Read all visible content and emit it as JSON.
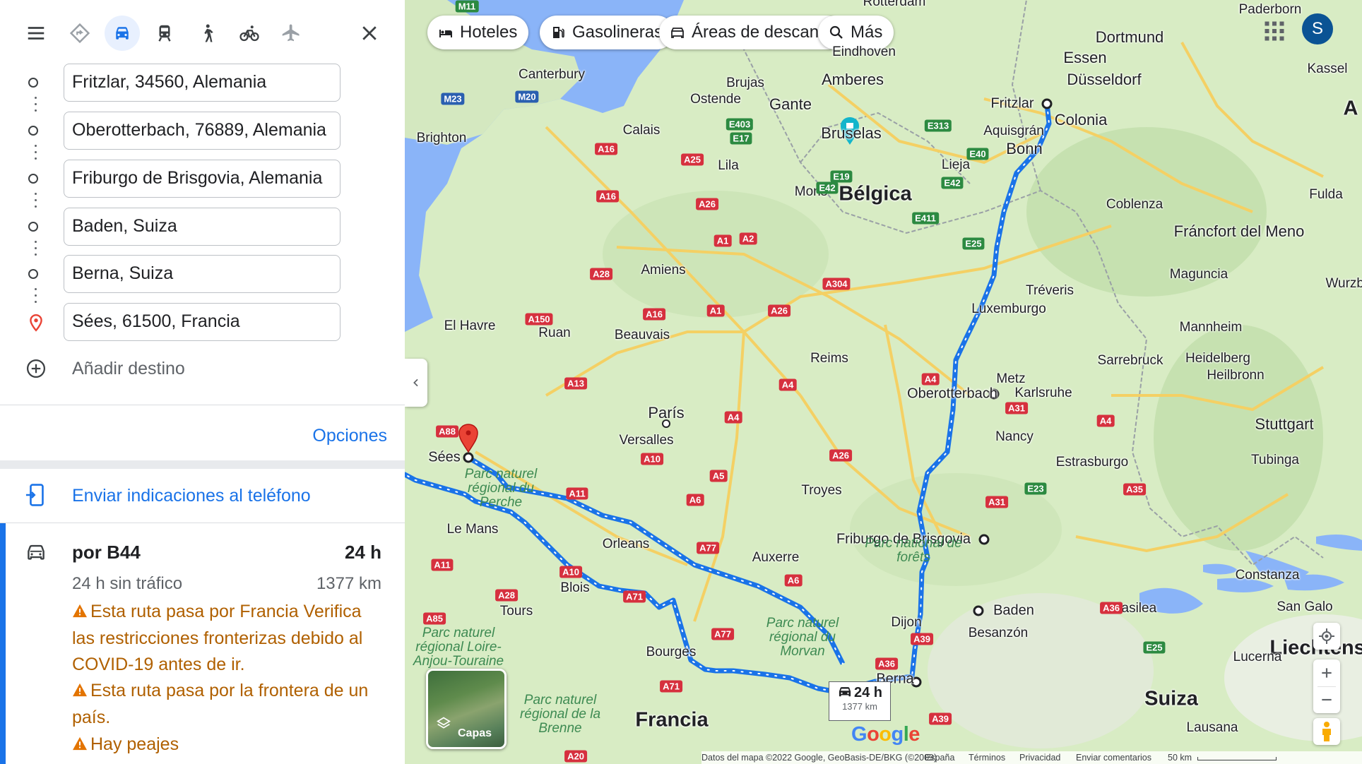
{
  "sidebar": {
    "toolbar": {
      "menu_icon": "menu-icon",
      "modes": [
        {
          "name": "Mejor ruta",
          "icon": "directions-icon",
          "active": false
        },
        {
          "name": "Coche",
          "icon": "car-icon",
          "active": true
        },
        {
          "name": "Transporte público",
          "icon": "train-icon",
          "active": false
        },
        {
          "name": "A pie",
          "icon": "walk-icon",
          "active": false
        },
        {
          "name": "Bicicleta",
          "icon": "bike-icon",
          "active": false
        },
        {
          "name": "Vuelo",
          "icon": "plane-icon",
          "active": false
        }
      ],
      "close_icon": "close-icon"
    },
    "stops": [
      "Fritzlar, 34560, Alemania",
      "Oberotterbach, 76889, Alemania",
      "Friburgo de Brisgovia, Alemania",
      "Baden, Suiza",
      "Berna, Suiza",
      "Sées, 61500, Francia"
    ],
    "add_destination": "Añadir destino",
    "options": "Opciones",
    "send_to_phone": "Enviar indicaciones al teléfono",
    "route": {
      "via": "por B44",
      "time": "24 h",
      "traffic": "24 h sin tráfico",
      "distance": "1377 km",
      "warnings": [
        "Esta ruta pasa por Francia Verifica las restricciones fronterizas debido al COVID-19 antes de ir.",
        "Esta ruta pasa por la frontera de un país.",
        "Hay peajes"
      ]
    }
  },
  "map": {
    "chips": [
      {
        "label": "Hoteles",
        "icon": "hotel-icon"
      },
      {
        "label": "Gasolineras",
        "icon": "gas-station-icon"
      },
      {
        "label": "Áreas de descan...",
        "icon": "rest-area-icon"
      },
      {
        "label": "Más",
        "icon": "search-icon"
      }
    ],
    "account_initial": "S",
    "route_box": {
      "time": "24 h",
      "distance": "1377 km"
    },
    "layers_label": "Capas",
    "countries": [
      "Bélgica",
      "Francia",
      "Suiza",
      "Liechtenste"
    ],
    "route_labels": [
      "Fritzlar",
      "Oberotterbach",
      "Friburgo de Brisgovia",
      "Baden",
      "Berna",
      "Sées"
    ],
    "cities": [
      "Rotterdam",
      "Paderborn",
      "Dortmund",
      "Eindhoven",
      "Essen",
      "Kassel",
      "Canterbury",
      "Brujas",
      "Amberes",
      "Düsseldorf",
      "Ostende",
      "Gante",
      "Colonia",
      "Brighton",
      "Calais",
      "Bruselas",
      "Aquisgrán",
      "Bonn",
      "Lila",
      "Lieja",
      "Mons",
      "Coblenza",
      "Fulda",
      "Fráncfort del Meno",
      "Maguncia",
      "Wurzbu",
      "Amiens",
      "Tréveris",
      "Luxemburgo",
      "Mannheim",
      "El Havre",
      "Ruan",
      "Beauvais",
      "Sarrebruck",
      "Heidelberg",
      "Reims",
      "Heilbronn",
      "Metz",
      "Karlsruhe",
      "París",
      "Stuttgart",
      "Versalles",
      "Nancy",
      "Estrasburgo",
      "Tubinga",
      "Troyes",
      "Le Mans",
      "Orleans",
      "Auxerre",
      "Constanza",
      "Blois",
      "Tours",
      "Basilea",
      "San Galo",
      "Dijon",
      "Besanzón",
      "Lucerna",
      "Bourges",
      "Lausana",
      "A"
    ],
    "parks": [
      "Parc naturel régional du Perche",
      "Parc national de forêts",
      "Parc naturel régional du Morvan",
      "Parc naturel régional Loire-Anjou-Touraine",
      "Parc naturel régional de la Brenne"
    ],
    "footer": {
      "data": "Datos del mapa ©2022 Google, GeoBasis-DE/BKG (©2009)",
      "country": "España",
      "terms": "Términos",
      "privacy": "Privacidad",
      "feedback": "Enviar comentarios",
      "scale": "50 km"
    },
    "logo": "Google",
    "route_color": "#1a73e8",
    "land_color": "#d8ecc4",
    "water_color": "#8ab4f8"
  }
}
